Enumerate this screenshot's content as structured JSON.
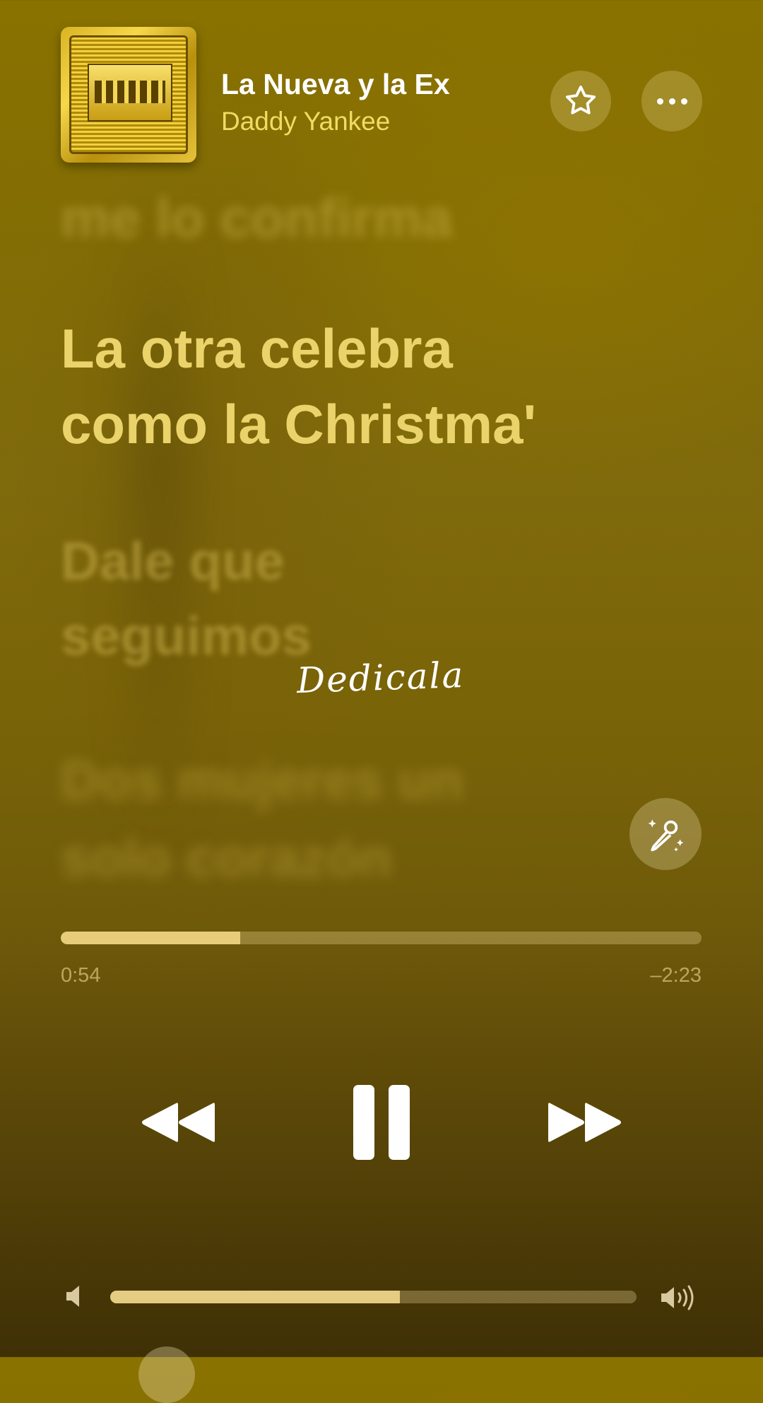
{
  "header": {
    "song_title": "La Nueva y la Ex",
    "artist": "Daddy Yankee",
    "album_art": "album-artwork",
    "favorite_icon": "star-icon",
    "more_icon": "ellipsis-icon"
  },
  "lyrics": {
    "previous": "me lo confirma",
    "current_line1": "La otra celebra",
    "current_line2": "como la Christma'",
    "next_line1": "Dale que",
    "next_line2": "seguimos",
    "next2_line1": "Dos mujeres un",
    "next2_line2": "solo corazón"
  },
  "overlay": {
    "handwritten_text": "Dedicala"
  },
  "sing_button": {
    "icon": "microphone-sparkle-icon"
  },
  "playback": {
    "elapsed": "0:54",
    "remaining": "–2:23",
    "progress_fraction": 0.28,
    "play_state_icon": "pause-icon"
  },
  "controls": {
    "rewind_icon": "backward-icon",
    "forward_icon": "forward-icon"
  },
  "volume": {
    "level_fraction": 0.55,
    "low_icon": "speaker-low-icon",
    "high_icon": "speaker-high-icon"
  },
  "colors": {
    "accent_text": "#f1dc63",
    "current_lyric": "#ead36a",
    "progress_fill": "#e7cd7a"
  }
}
